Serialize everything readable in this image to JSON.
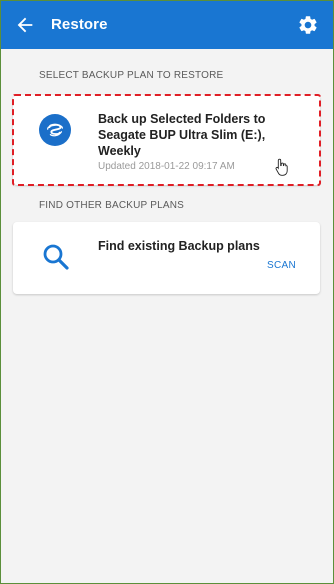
{
  "header": {
    "title": "Restore",
    "back_icon": "arrow-left-icon",
    "settings_icon": "gear-icon"
  },
  "sections": {
    "select_label": "SELECT BACKUP PLAN TO RESTORE",
    "find_label": "FIND OTHER BACKUP PLANS"
  },
  "plan": {
    "name": "Back up Selected Folders to Seagate BUP Ultra Slim (E:), Weekly",
    "updated": "Updated 2018-01-22 09:17 AM",
    "icon": "seagate-logo-icon"
  },
  "find": {
    "label": "Find existing Backup plans",
    "action": "SCAN",
    "icon": "search-icon"
  },
  "colors": {
    "appbar": "#1976d2",
    "accent": "#1976d2",
    "highlight": "#e01e26",
    "background": "#f3f3f3"
  }
}
